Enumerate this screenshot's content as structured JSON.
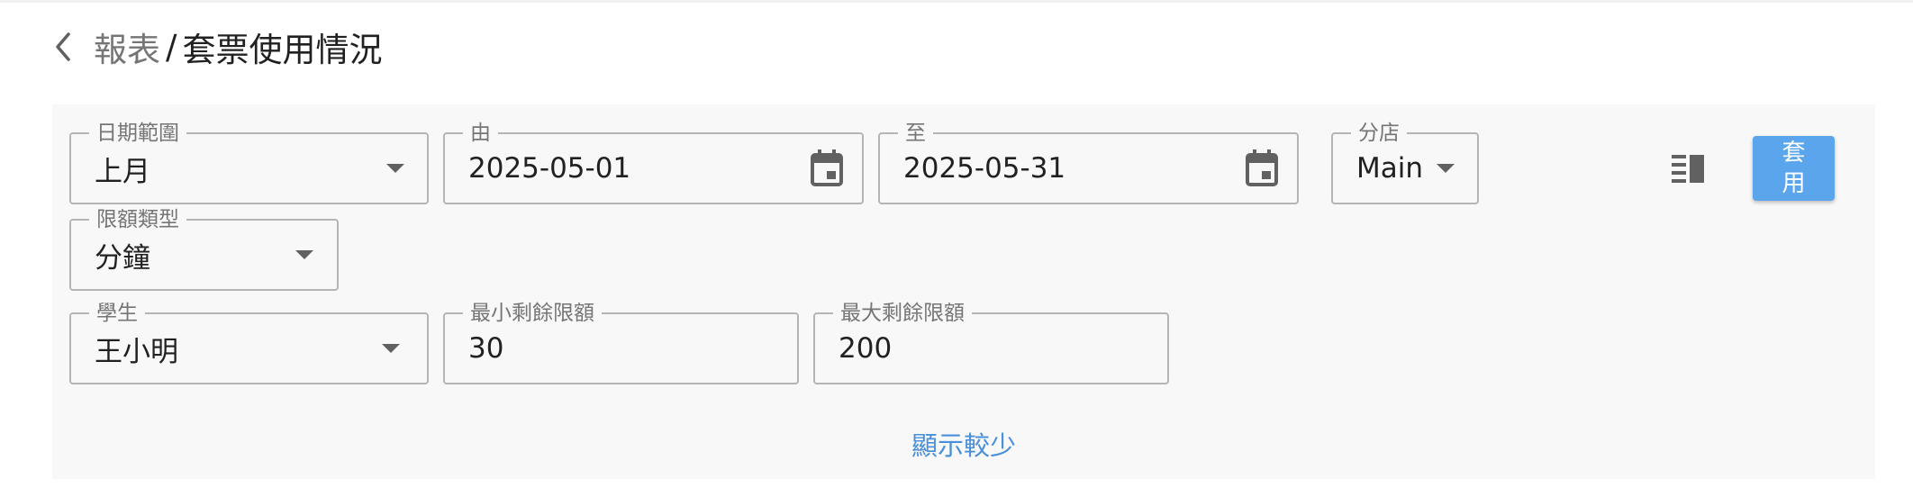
{
  "breadcrumb": {
    "parent": "報表",
    "separator": "/",
    "current": "套票使用情況"
  },
  "filters": {
    "date_range": {
      "label": "日期範圍",
      "value": "上月"
    },
    "from": {
      "label": "由",
      "value": "2025-05-01"
    },
    "to": {
      "label": "至",
      "value": "2025-05-31"
    },
    "branch": {
      "label": "分店",
      "value": "Main"
    },
    "quota_type": {
      "label": "限額類型",
      "value": "分鐘"
    },
    "student": {
      "label": "學生",
      "value": "王小明"
    },
    "min_remaining": {
      "label": "最小剩餘限額",
      "value": "30"
    },
    "max_remaining": {
      "label": "最大剩餘限額",
      "value": "200"
    }
  },
  "toolbar": {
    "apply_label": "套用",
    "view_toggle_icon": "view-columns-icon"
  },
  "show_less_label": "顯示較少",
  "colors": {
    "accent": "#5aa5ec",
    "link": "#4a90d9",
    "panel": "#f8f8f8"
  }
}
